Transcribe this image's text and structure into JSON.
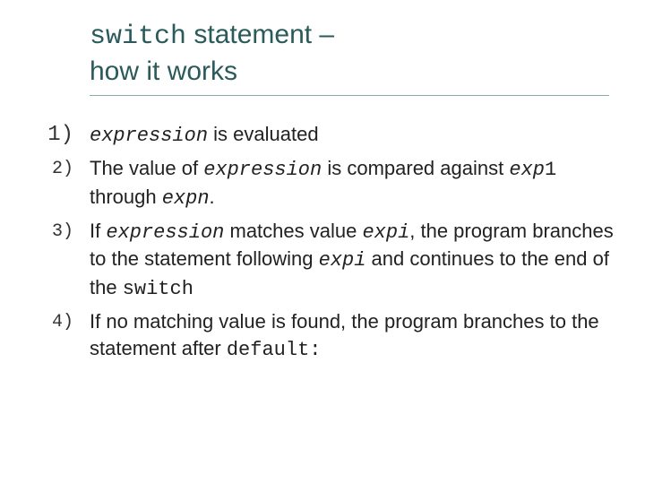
{
  "title": {
    "code": "switch",
    "rest1": " statement –",
    "line2": "how it works"
  },
  "items": [
    {
      "num": "1)",
      "parts": [
        {
          "t": "expression",
          "mono": true,
          "i": true
        },
        {
          "t": " is evaluated"
        }
      ]
    },
    {
      "num": "2)",
      "parts": [
        {
          "t": "The value of "
        },
        {
          "t": "expression",
          "mono": true,
          "i": true
        },
        {
          "t": " is compared against "
        },
        {
          "t": "exp",
          "mono": true,
          "i": true
        },
        {
          "t": "1",
          "mono": true
        },
        {
          "t": " through "
        },
        {
          "t": "exp",
          "mono": true,
          "i": true
        },
        {
          "t": "n",
          "mono": true,
          "i": true
        },
        {
          "t": "."
        }
      ]
    },
    {
      "num": "3)",
      "parts": [
        {
          "t": "If "
        },
        {
          "t": "expression",
          "mono": true,
          "i": true
        },
        {
          "t": " matches value "
        },
        {
          "t": "exp",
          "mono": true,
          "i": true
        },
        {
          "t": "i",
          "mono": true,
          "i": true
        },
        {
          "t": ", the program branches to the statement following "
        },
        {
          "t": "exp",
          "mono": true,
          "i": true
        },
        {
          "t": "i",
          "mono": true,
          "i": true
        },
        {
          "t": " and continues to the end of the "
        },
        {
          "t": "switch",
          "mono": true
        }
      ]
    },
    {
      "num": "4)",
      "parts": [
        {
          "t": "If no matching value is found, the program branches to the statement after "
        },
        {
          "t": "default:",
          "mono": true
        }
      ]
    }
  ]
}
